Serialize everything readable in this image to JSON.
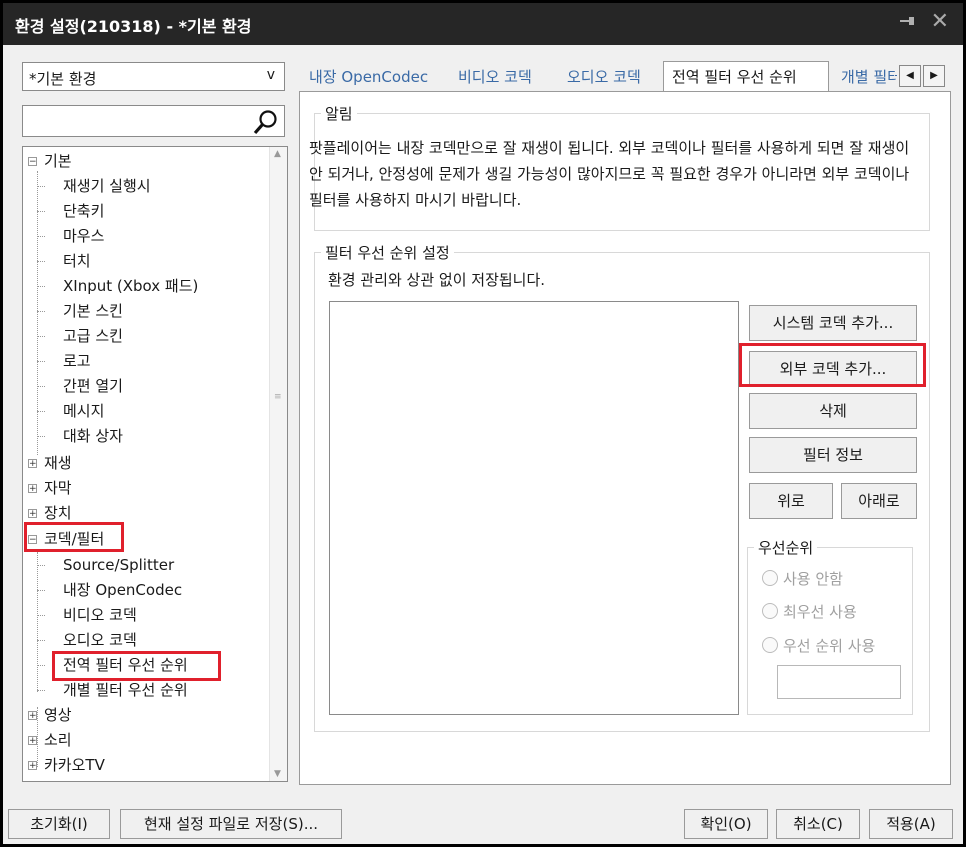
{
  "window": {
    "title": "환경 설정(210318) - *기본 환경",
    "pin_glyph": "📌",
    "close_glyph": "✕"
  },
  "profile_select": {
    "value": "*기본 환경",
    "arrow": "v"
  },
  "search": {
    "placeholder": "",
    "icon": "search-icon"
  },
  "tree": {
    "items": [
      {
        "label": "기본",
        "level": 0,
        "expander": "⊟"
      },
      {
        "label": "재생기 실행시",
        "level": 1
      },
      {
        "label": "단축키",
        "level": 1
      },
      {
        "label": "마우스",
        "level": 1
      },
      {
        "label": "터치",
        "level": 1
      },
      {
        "label": "XInput (Xbox 패드)",
        "level": 1
      },
      {
        "label": "기본 스킨",
        "level": 1
      },
      {
        "label": "고급 스킨",
        "level": 1
      },
      {
        "label": "로고",
        "level": 1
      },
      {
        "label": "간편 열기",
        "level": 1
      },
      {
        "label": "메시지",
        "level": 1
      },
      {
        "label": "대화 상자",
        "level": 1
      },
      {
        "label": "재생",
        "level": 0,
        "expander": "⊞"
      },
      {
        "label": "자막",
        "level": 0,
        "expander": "⊞"
      },
      {
        "label": "장치",
        "level": 0,
        "expander": "⊞"
      },
      {
        "label": "코덱/필터",
        "level": 0,
        "expander": "⊟"
      },
      {
        "label": "Source/Splitter",
        "level": 1
      },
      {
        "label": "내장 OpenCodec",
        "level": 1
      },
      {
        "label": "비디오 코덱",
        "level": 1
      },
      {
        "label": "오디오 코덱",
        "level": 1
      },
      {
        "label": "전역 필터 우선 순위",
        "level": 1
      },
      {
        "label": "개별 필터 우선 순위",
        "level": 1
      },
      {
        "label": "영상",
        "level": 0,
        "expander": "⊞"
      },
      {
        "label": "소리",
        "level": 0,
        "expander": "⊞"
      },
      {
        "label": "카카오TV",
        "level": 0,
        "expander": "⊞"
      }
    ]
  },
  "tabs": [
    {
      "label": "내장 OpenCodec"
    },
    {
      "label": "비디오 코덱"
    },
    {
      "label": "오디오 코덱"
    },
    {
      "label": "전역 필터 우선 순위"
    },
    {
      "label": "개별 필터 우선 순위"
    }
  ],
  "notice": {
    "legend": "알림",
    "text": "팟플레이어는 내장 코덱만으로 잘 재생이 됩니다. 외부 코덱이나 필터를 사용하게 되면 잘 재생이 안 되거나, 안정성에 문제가 생길 가능성이 많아지므로 꼭 필요한 경우가 아니라면 외부 코덱이나 필터를 사용하지 마시기 바랍니다."
  },
  "filter_priority": {
    "legend": "필터 우선 순위 설정",
    "note": "환경 관리와 상관 없이 저장됩니다.",
    "buttons": {
      "add_system": "시스템 코덱 추가...",
      "add_external": "외부 코덱 추가...",
      "delete": "삭제",
      "info": "필터 정보",
      "up": "위로",
      "down": "아래로"
    },
    "priority_group": {
      "legend": "우선순위",
      "options": [
        "사용 안함",
        "최우선 사용",
        "우선 순위 사용"
      ]
    }
  },
  "footer": {
    "reset": "초기화(I)",
    "save_file": "현재 설정 파일로 저장(S)...",
    "ok": "확인(O)",
    "cancel": "취소(C)",
    "apply": "적용(A)"
  }
}
